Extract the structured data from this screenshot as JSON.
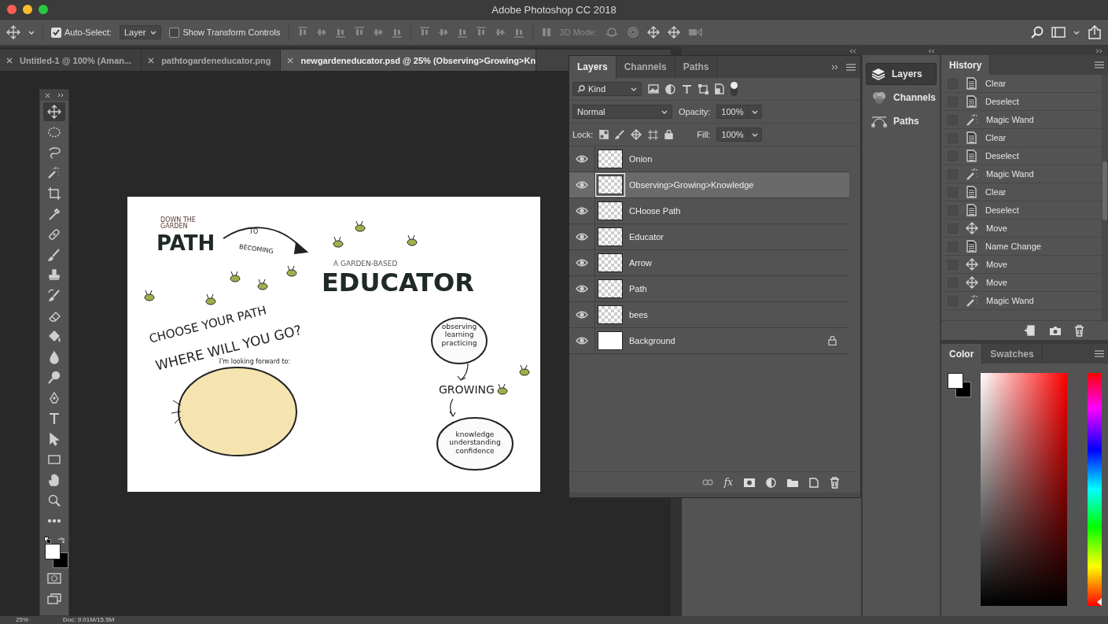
{
  "window": {
    "title": "Adobe Photoshop CC 2018"
  },
  "options_bar": {
    "auto_select": {
      "label": "Auto-Select:",
      "checked": true
    },
    "target": "Layer",
    "transform_controls": {
      "label": "Show Transform Controls",
      "checked": false
    },
    "mode_3d_label": "3D Mode:"
  },
  "document_tabs": [
    {
      "title": "Untitled-1 @ 100% (Aman...",
      "selected": false
    },
    {
      "title": "pathtogardeneducator.png",
      "selected": false
    },
    {
      "title": "newgardeneducator.psd @ 25% (Observing>Growing>Kn",
      "selected": true
    }
  ],
  "tools": [
    {
      "selected": true
    },
    {
      "selected": false
    },
    {
      "selected": false
    },
    {
      "selected": false
    },
    {
      "selected": false
    },
    {
      "selected": false
    },
    {
      "selected": false
    },
    {
      "selected": false
    },
    {
      "selected": false
    },
    {
      "selected": false
    },
    {
      "selected": false
    },
    {
      "selected": false
    },
    {
      "selected": false
    },
    {
      "selected": false
    },
    {
      "selected": false
    },
    {
      "selected": false
    },
    {
      "selected": false
    },
    {
      "selected": false
    },
    {
      "selected": false
    },
    {
      "selected": false
    },
    {
      "selected": false
    }
  ],
  "artwork": {
    "texts": [
      "DOWN THE GARDEN",
      "PATH",
      "TO",
      "BECOMING",
      "A GARDEN-BASED",
      "EDUCATOR",
      "CHOOSE YOUR PATH",
      "WHERE WILL YOU GO?",
      "I'm looking forward to:",
      "observing learning practicing",
      "GROWING",
      "knowledge understanding confidence"
    ]
  },
  "layers_panel": {
    "tabs": [
      {
        "label": "Layers",
        "selected": true
      },
      {
        "label": "Channels",
        "selected": false
      },
      {
        "label": "Paths",
        "selected": false
      }
    ],
    "filter": "Kind",
    "blend_mode": "Normal",
    "opacity_label": "Opacity:",
    "opacity": "100%",
    "lock_label": "Lock:",
    "fill_label": "Fill:",
    "fill": "100%",
    "layers": [
      {
        "name": "Onion",
        "kind": "pixel",
        "visible": true,
        "selected": false,
        "locked": false
      },
      {
        "name": "Observing>Growing>Knowledge",
        "kind": "pixel",
        "visible": true,
        "selected": true,
        "locked": false
      },
      {
        "name": "CHoose Path",
        "kind": "pixel",
        "visible": true,
        "selected": false,
        "locked": false
      },
      {
        "name": "Educator",
        "kind": "pixel",
        "visible": true,
        "selected": false,
        "locked": false
      },
      {
        "name": "Arrow",
        "kind": "pixel",
        "visible": true,
        "selected": false,
        "locked": false
      },
      {
        "name": "Path",
        "kind": "pixel",
        "visible": true,
        "selected": false,
        "locked": false
      },
      {
        "name": "bees",
        "kind": "pixel",
        "visible": true,
        "selected": false,
        "locked": false
      },
      {
        "name": "Background",
        "kind": "background",
        "visible": true,
        "selected": false,
        "locked": true
      }
    ],
    "fx_label": "fx"
  },
  "dock": [
    {
      "label": "Layers",
      "selected": true
    },
    {
      "label": "Channels",
      "selected": false
    },
    {
      "label": "Paths",
      "selected": false
    }
  ],
  "history_panel": {
    "title": "History",
    "items": [
      {
        "kind": "document",
        "name": "Clear",
        "checked": false
      },
      {
        "kind": "document",
        "name": "Deselect",
        "checked": false
      },
      {
        "kind": "wand",
        "name": "Magic Wand",
        "checked": false
      },
      {
        "kind": "document",
        "name": "Clear",
        "checked": false
      },
      {
        "kind": "document",
        "name": "Deselect",
        "checked": false
      },
      {
        "kind": "wand",
        "name": "Magic Wand",
        "checked": false
      },
      {
        "kind": "document",
        "name": "Clear",
        "checked": false
      },
      {
        "kind": "document",
        "name": "Deselect",
        "checked": false
      },
      {
        "kind": "move",
        "name": "Move",
        "checked": false
      },
      {
        "kind": "document",
        "name": "Name Change",
        "checked": false
      },
      {
        "kind": "move",
        "name": "Move",
        "checked": false
      },
      {
        "kind": "move",
        "name": "Move",
        "checked": false
      },
      {
        "kind": "wand",
        "name": "Magic Wand",
        "checked": false
      }
    ]
  },
  "color_panel": {
    "tabs": [
      {
        "label": "Color",
        "selected": true
      },
      {
        "label": "Swatches",
        "selected": false
      }
    ],
    "hue": {
      "level": 0
    }
  },
  "status_bar": {
    "zoom": "25%",
    "doc_info": "Doc: 9.01M/15.5M"
  }
}
